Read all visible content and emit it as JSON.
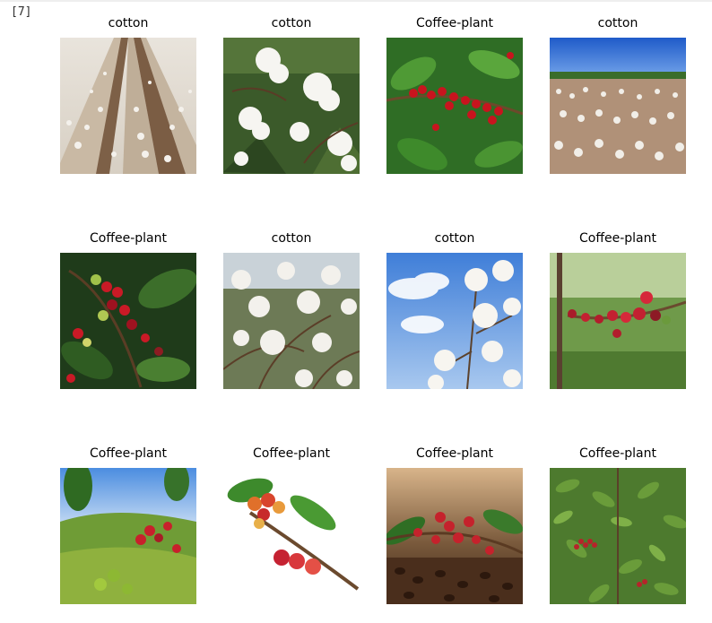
{
  "cell": {
    "prompt": "[7]"
  },
  "images": [
    {
      "title": "cotton",
      "subject": "cotton-field-rows"
    },
    {
      "title": "cotton",
      "subject": "cotton-bolls-closeup"
    },
    {
      "title": "Coffee-plant",
      "subject": "coffee-cherries-on-branch"
    },
    {
      "title": "cotton",
      "subject": "cotton-field-blue-sky"
    },
    {
      "title": "Coffee-plant",
      "subject": "coffee-cherries-mixed-ripeness"
    },
    {
      "title": "cotton",
      "subject": "cotton-plant-open-bolls"
    },
    {
      "title": "cotton",
      "subject": "cotton-against-sky"
    },
    {
      "title": "Coffee-plant",
      "subject": "coffee-branch-red-cherries"
    },
    {
      "title": "Coffee-plant",
      "subject": "coffee-plantation-hillside"
    },
    {
      "title": "Coffee-plant",
      "subject": "coffee-cherries-white-background"
    },
    {
      "title": "Coffee-plant",
      "subject": "coffee-cherries-over-beans"
    },
    {
      "title": "Coffee-plant",
      "subject": "coffee-bush-dense"
    }
  ],
  "colors": {
    "cotton_white": "#f2f0ec",
    "soil_brown": "#8b6b4e",
    "leaf_green": "#3f7a2c",
    "cherry_red": "#c0202a",
    "sky_blue": "#4a86d8"
  }
}
